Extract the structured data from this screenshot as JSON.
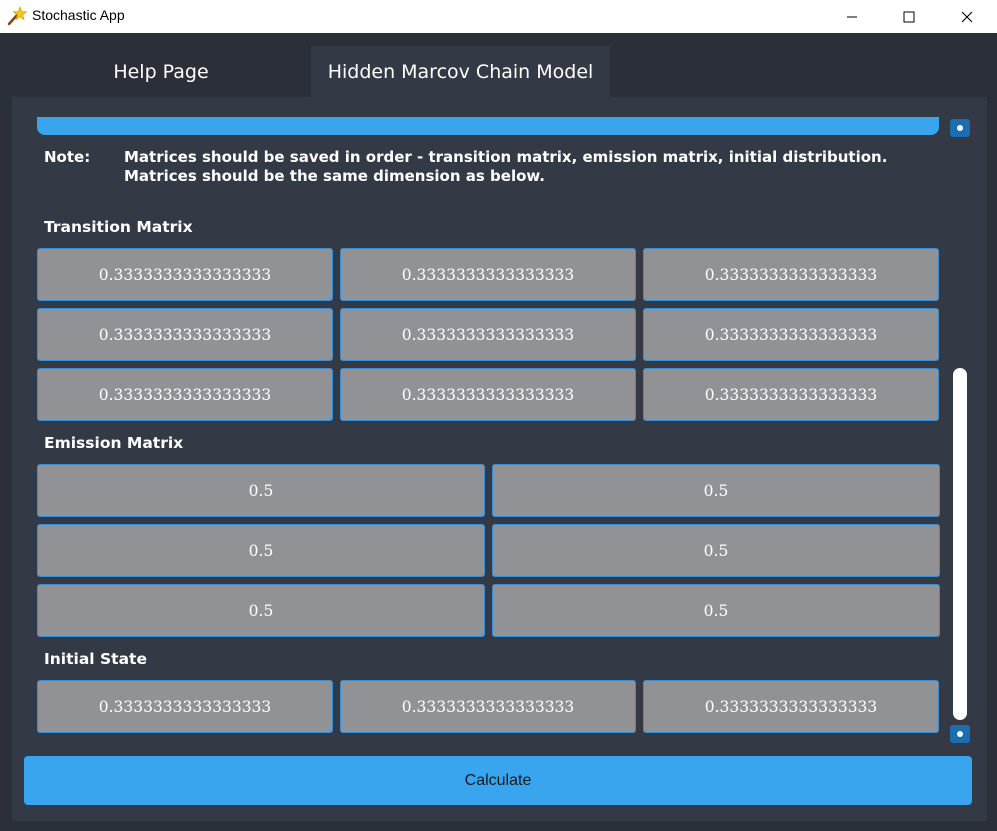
{
  "window": {
    "title": "Stochastic App",
    "icon": "star-wand-icon",
    "controls": [
      "minimize-icon",
      "maximize-icon",
      "close-icon"
    ]
  },
  "tabs": [
    {
      "label": "Help Page",
      "active": false
    },
    {
      "label": "Hidden Marcov Chain Model",
      "active": true
    }
  ],
  "note": {
    "label": "Note:",
    "line1": "Matrices should be saved in order - transition matrix, emission matrix, initial distribution.",
    "line2": "Matrices should be the same dimension as below."
  },
  "transition": {
    "title": "Transition Matrix",
    "rows": [
      [
        "0.3333333333333333",
        "0.3333333333333333",
        "0.3333333333333333"
      ],
      [
        "0.3333333333333333",
        "0.3333333333333333",
        "0.3333333333333333"
      ],
      [
        "0.3333333333333333",
        "0.3333333333333333",
        "0.3333333333333333"
      ]
    ]
  },
  "emission": {
    "title": "Emission Matrix",
    "rows": [
      [
        "0.5",
        "0.5"
      ],
      [
        "0.5",
        "0.5"
      ],
      [
        "0.5",
        "0.5"
      ]
    ]
  },
  "initial": {
    "title": "Initial State",
    "values": [
      "0.3333333333333333",
      "0.3333333333333333",
      "0.3333333333333333"
    ]
  },
  "calculate_label": "Calculate",
  "colors": {
    "accent": "#39a5ee",
    "background": "#2b2f38",
    "panel": "#333a45",
    "cell": "#919296"
  }
}
